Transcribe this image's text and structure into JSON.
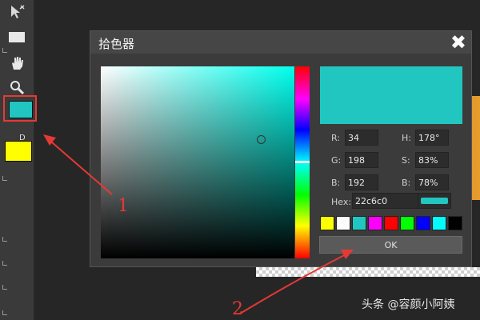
{
  "dialog": {
    "title": "拾色器",
    "close_label": "✖",
    "current_hue_color": "#00ffee",
    "preview_color": "#22c6c0",
    "fields": {
      "r_label": "R:",
      "r_value": "34",
      "g_label": "G:",
      "g_value": "198",
      "b_label": "B:",
      "b_value": "192",
      "h_label": "H:",
      "h_value": "178°",
      "s_label": "S:",
      "s_value": "83%",
      "v_label": "B:",
      "v_value": "78%",
      "hex_label": "Hex:",
      "hex_value": "22c6c0"
    },
    "palette": [
      "#ffff00",
      "#ffffff",
      "#22c6c0",
      "#ff00ff",
      "#ff0000",
      "#00ff00",
      "#0000ff",
      "#00ffff",
      "#000000"
    ],
    "ok_label": "OK"
  },
  "toolbar": {
    "foreground_color": "#22c6c0",
    "background_color": "#ffff00",
    "default_badge": "D",
    "tools": [
      "pointer-icon",
      "rectangle-icon",
      "hand-icon",
      "zoom-icon"
    ]
  },
  "annotations": {
    "label_1": "1",
    "label_2": "2",
    "color": "#e53935"
  },
  "watermark": "头条 @容颜小阿姨"
}
